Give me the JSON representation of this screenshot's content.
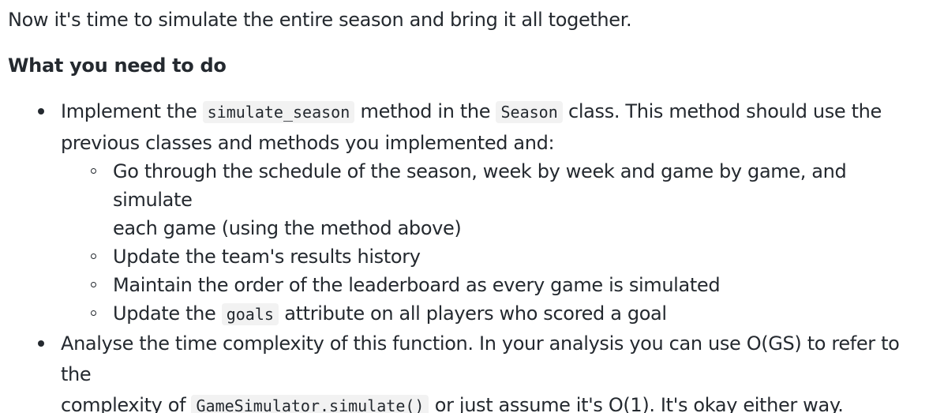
{
  "intro": "Now it's time to simulate the entire season and bring it all together.",
  "heading": "What you need to do",
  "bullet1": {
    "text_a": "Implement the ",
    "code_a": "simulate_season",
    "text_b": " method in the ",
    "code_b": "Season",
    "text_c": " class. This method should use the",
    "text_d": "previous classes and methods you implemented and:",
    "sub": [
      {
        "line1": "Go through the schedule of the season, week by week and game by game, and simulate",
        "line2": "each game (using the method above)"
      },
      {
        "text": "Update the team's results history"
      },
      {
        "text": "Maintain the order of the leaderboard as every game is simulated"
      },
      {
        "text_a": "Update the ",
        "code": "goals",
        "text_b": " attribute on all players who scored a goal"
      }
    ]
  },
  "bullet2": {
    "line1": "Analyse the time complexity of this function. In your analysis you can use O(GS) to refer to the",
    "text_a": "complexity of ",
    "code": "GameSimulator.simulate()",
    "text_b": " or just assume it's O(1). It's okay either way."
  }
}
